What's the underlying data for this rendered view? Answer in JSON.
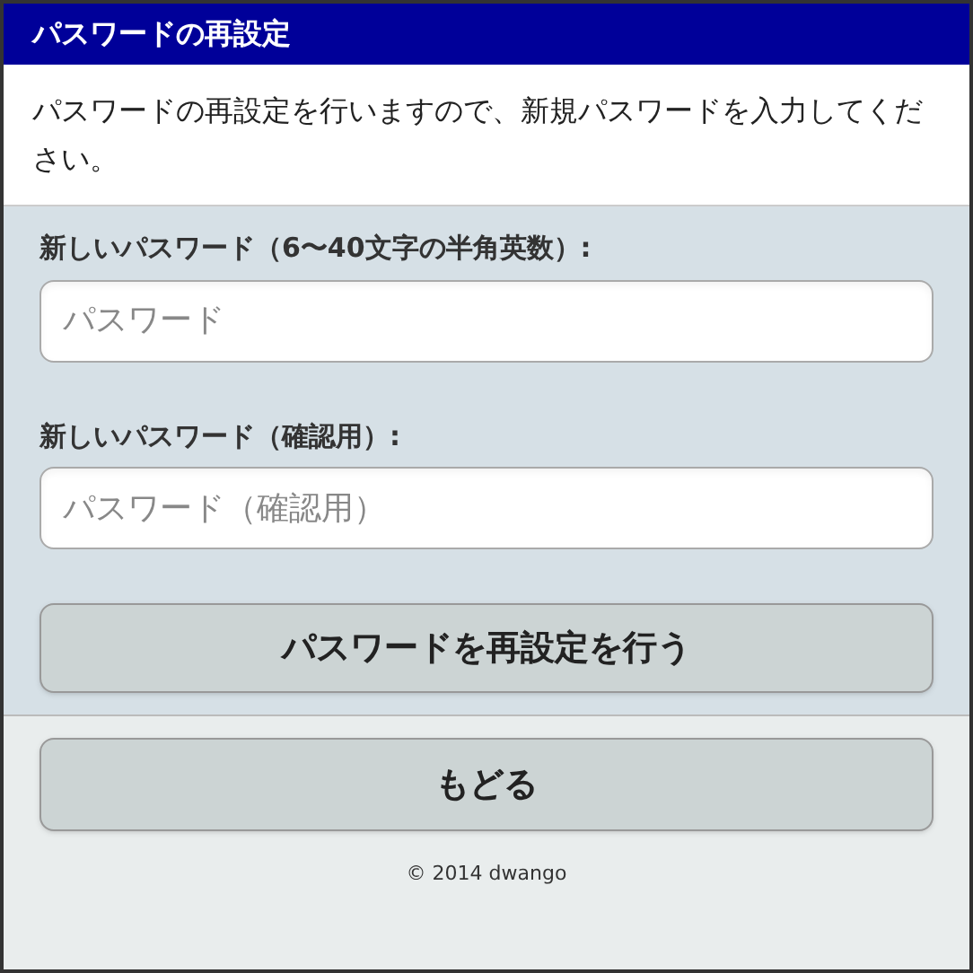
{
  "header": {
    "title": "パスワードの再設定"
  },
  "description": "パスワードの再設定を行いますので、新規パスワードを入力してください。",
  "fields": [
    {
      "label": "新しいパスワード（6〜40文字の半角英数）:",
      "placeholder": "パスワード"
    },
    {
      "label": "新しいパスワード（確認用）:",
      "placeholder": "パスワード（確認用）"
    }
  ],
  "submit_button": "パスワードを再設定を行う",
  "back_button": "もどる",
  "footer": "© 2014 dwango"
}
